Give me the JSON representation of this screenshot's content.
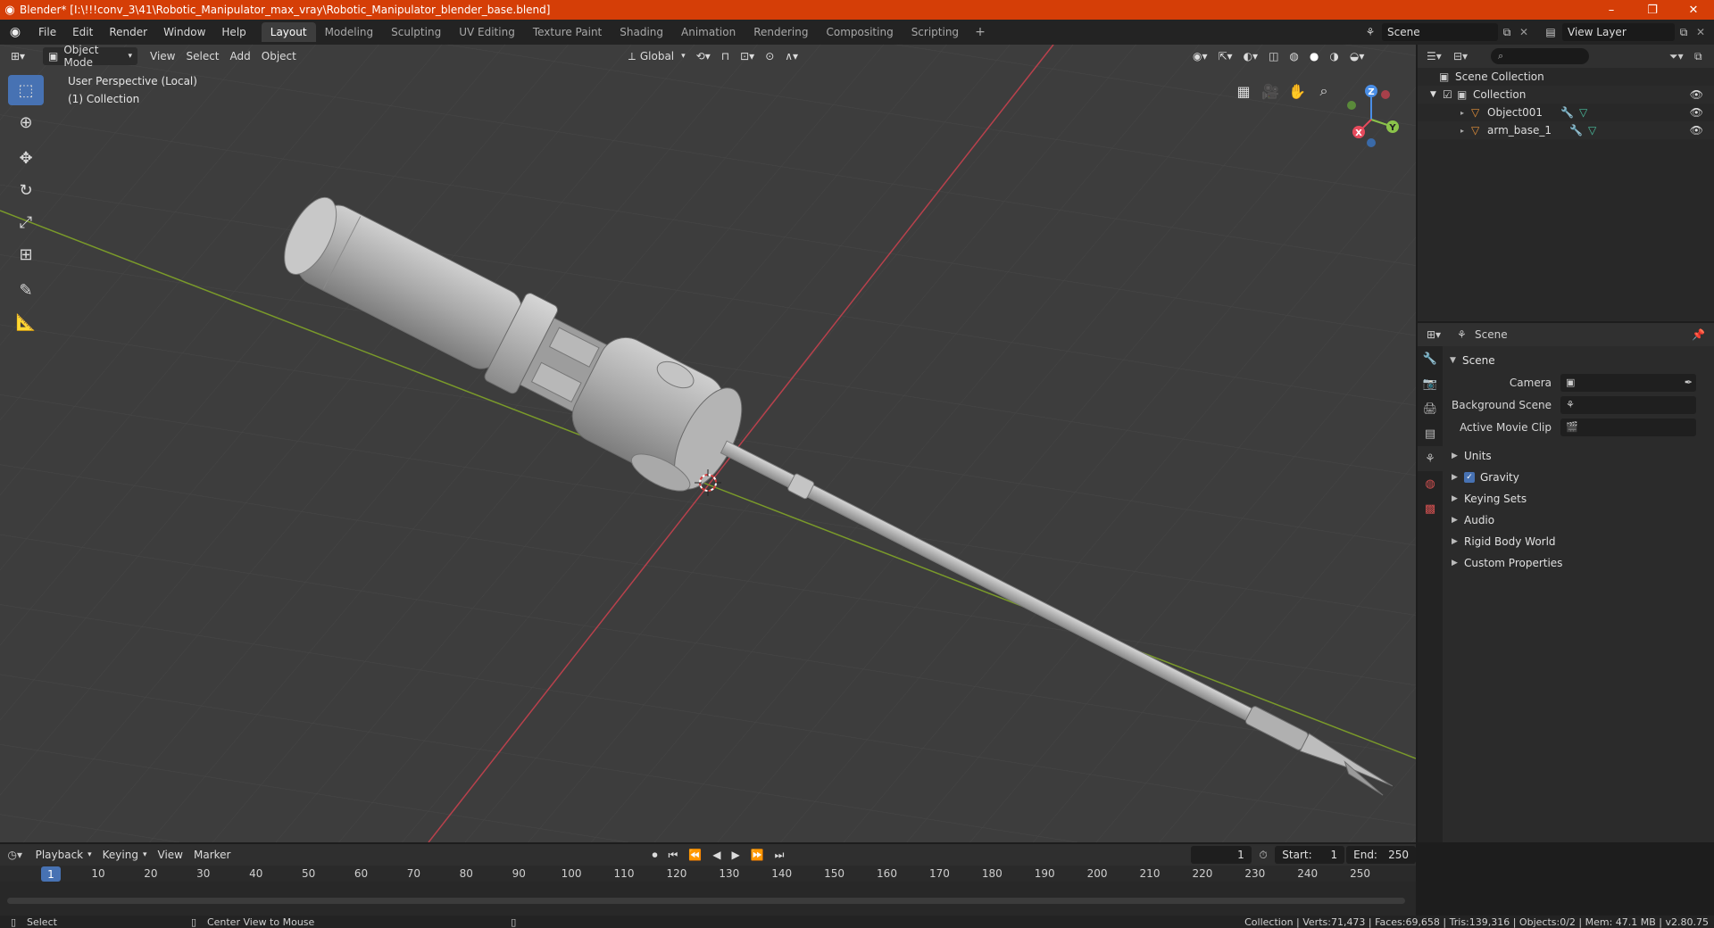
{
  "window": {
    "title": "Blender* [I:\\!!!conv_3\\41\\Robotic_Manipulator_max_vray\\Robotic_Manipulator_blender_base.blend]",
    "controls": [
      "–",
      "❐",
      "✕"
    ]
  },
  "menu": [
    "File",
    "Edit",
    "Render",
    "Window",
    "Help"
  ],
  "workspaces": {
    "tabs": [
      "Layout",
      "Modeling",
      "Sculpting",
      "UV Editing",
      "Texture Paint",
      "Shading",
      "Animation",
      "Rendering",
      "Compositing",
      "Scripting"
    ],
    "active": "Layout",
    "add": "+"
  },
  "scene_selector": "Scene",
  "view_layer_selector": "View Layer",
  "viewport": {
    "mode": "Object Mode",
    "menus": [
      "View",
      "Select",
      "Add",
      "Object"
    ],
    "orientation": "Global",
    "perspective_label": "User Perspective (Local)",
    "collection_label": "(1) Collection",
    "gizmo_axes": [
      "X",
      "Y",
      "Z"
    ]
  },
  "outliner": {
    "root": "Scene Collection",
    "collection": "Collection",
    "objects": [
      "Object001",
      "arm_base_1"
    ]
  },
  "properties": {
    "context": "Scene",
    "panel": "Scene",
    "fields": [
      {
        "label": "Camera",
        "value": ""
      },
      {
        "label": "Background Scene",
        "value": ""
      },
      {
        "label": "Active Movie Clip",
        "value": ""
      }
    ],
    "subpanels": [
      {
        "label": "Units",
        "checkbox": false
      },
      {
        "label": "Gravity",
        "checkbox": true
      },
      {
        "label": "Keying Sets",
        "checkbox": false
      },
      {
        "label": "Audio",
        "checkbox": false
      },
      {
        "label": "Rigid Body World",
        "checkbox": false
      },
      {
        "label": "Custom Properties",
        "checkbox": false
      }
    ]
  },
  "timeline": {
    "menus": [
      "Playback",
      "Keying",
      "View",
      "Marker"
    ],
    "current_frame": "1",
    "start_label": "Start:",
    "start": "1",
    "end_label": "End:",
    "end": "250",
    "ticks": [
      "10",
      "20",
      "30",
      "40",
      "50",
      "60",
      "70",
      "80",
      "90",
      "100",
      "110",
      "120",
      "130",
      "140",
      "150",
      "160",
      "170",
      "180",
      "190",
      "200",
      "210",
      "220",
      "230",
      "240",
      "250"
    ]
  },
  "statusbar": {
    "select": "Select",
    "center_view": "Center View to Mouse",
    "stats": "Collection | Verts:71,473 | Faces:69,658 | Tris:139,316 | Objects:0/2 | Mem: 47.1 MB | v2.80.75"
  },
  "colors": {
    "titlebar": "#d53e07",
    "accent": "#4772b3",
    "x_axis": "#e64a5c",
    "y_axis": "#8bc34a",
    "z_axis": "#4a8ee6"
  }
}
